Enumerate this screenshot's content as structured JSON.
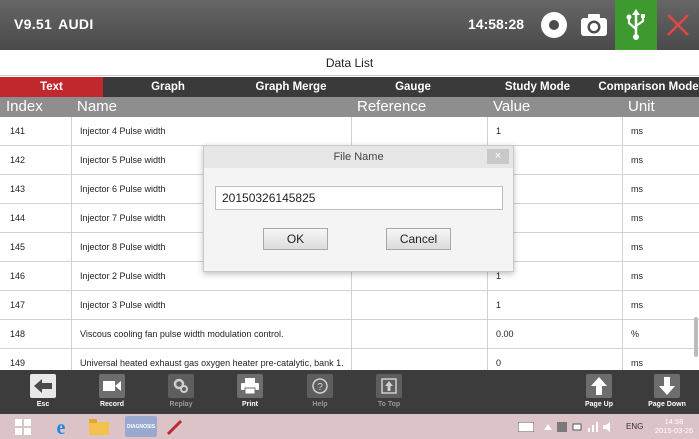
{
  "header": {
    "version": "V9.51",
    "make": "AUDI",
    "time": "14:58:28",
    "icons": [
      "record-icon",
      "camera-icon",
      "usb-icon",
      "close-icon"
    ],
    "colors": {
      "usb_bg": "#3e9a2f",
      "close": "#e04848"
    }
  },
  "page": {
    "title": "Data List"
  },
  "tabs": [
    {
      "label": "Text",
      "active": true
    },
    {
      "label": "Graph",
      "active": false
    },
    {
      "label": "Graph Merge",
      "active": false
    },
    {
      "label": "Gauge",
      "active": false
    },
    {
      "label": "Study Mode",
      "active": false
    },
    {
      "label": "Comparison Mode",
      "active": false
    }
  ],
  "columns": {
    "index": "Index",
    "name": "Name",
    "reference": "Reference",
    "value": "Value",
    "unit": "Unit"
  },
  "rows": [
    {
      "index": "141",
      "name": "Injector 4  Pulse width",
      "reference": "",
      "value": "1",
      "unit": "ms"
    },
    {
      "index": "142",
      "name": "Injector 5  Pulse width",
      "reference": "",
      "value": "",
      "unit": "ms"
    },
    {
      "index": "143",
      "name": "Injector 6  Pulse width",
      "reference": "",
      "value": "",
      "unit": "ms"
    },
    {
      "index": "144",
      "name": "Injector  7  Pulse width",
      "reference": "",
      "value": "",
      "unit": "ms"
    },
    {
      "index": "145",
      "name": "Injector  8  Pulse width",
      "reference": "",
      "value": "",
      "unit": "ms"
    },
    {
      "index": "146",
      "name": "Injector 2  Pulse width",
      "reference": "",
      "value": "1",
      "unit": "ms"
    },
    {
      "index": "147",
      "name": "Injector 3  Pulse width",
      "reference": "",
      "value": "1",
      "unit": "ms"
    },
    {
      "index": "148",
      "name": "Viscous cooling fan pulse width modulation control.",
      "reference": "",
      "value": "0.00",
      "unit": "%"
    },
    {
      "index": "149",
      "name": "Universal heated exhaust gas oxygen heater pre-catalytic, bank 1.",
      "reference": "",
      "value": "0",
      "unit": "ms"
    }
  ],
  "dialog": {
    "title": "File Name",
    "close_label": "×",
    "filename": "20150326145825",
    "ok_label": "OK",
    "cancel_label": "Cancel"
  },
  "toolbar": {
    "esc": "Esc",
    "record": "Record",
    "replay": "Replay",
    "print": "Print",
    "help": "Help",
    "to_top": "To Top",
    "page_up": "Page Up",
    "page_down": "Page Down"
  },
  "taskbar": {
    "app_label": "DIAGNOSIS",
    "tray_lang": "ENG",
    "clock_time": "14:58",
    "clock_date": "2015-03-26"
  }
}
